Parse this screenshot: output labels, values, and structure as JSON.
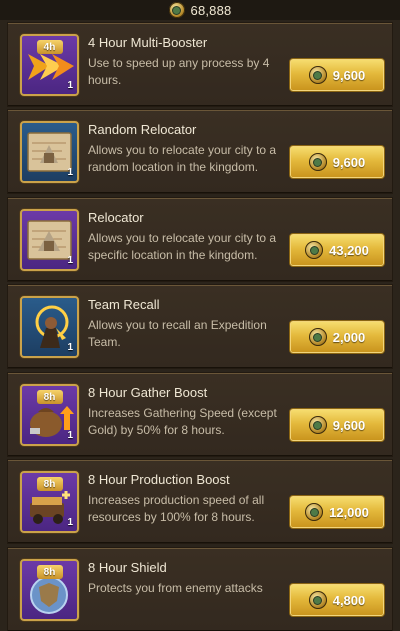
{
  "header": {
    "currency_icon": "coin-icon",
    "currency_total": "68,888"
  },
  "items": [
    {
      "name": "4 Hour Multi-Booster",
      "description": "Use to speed up any process by 4 hours.",
      "badge": "4h",
      "quantity": "1",
      "price": "9,600",
      "icon": "multi-booster-icon",
      "frame_color": "#6c3aa7"
    },
    {
      "name": "Random Relocator",
      "description": "Allows you to relocate your city to a random location in the kingdom.",
      "badge": "",
      "quantity": "1",
      "price": "9,600",
      "icon": "random-relocator-icon",
      "frame_color": "#2a5c8b"
    },
    {
      "name": "Relocator",
      "description": "Allows you to relocate your city to a specific location in the kingdom.",
      "badge": "",
      "quantity": "1",
      "price": "43,200",
      "icon": "relocator-icon",
      "frame_color": "#6c3aa7"
    },
    {
      "name": "Team Recall",
      "description": "Allows you to recall an Expedition Team.",
      "badge": "",
      "quantity": "1",
      "price": "2,000",
      "icon": "team-recall-icon",
      "frame_color": "#2a5c8b"
    },
    {
      "name": "8 Hour Gather Boost",
      "description": "Increases Gathering Speed (except Gold) by 50% for 8 hours.",
      "badge": "8h",
      "quantity": "1",
      "price": "9,600",
      "icon": "gather-boost-icon",
      "frame_color": "#6c3aa7"
    },
    {
      "name": "8 Hour Production Boost",
      "description": "Increases production speed of all resources by 100% for 8 hours.",
      "badge": "8h",
      "quantity": "1",
      "price": "12,000",
      "icon": "production-boost-icon",
      "frame_color": "#6c3aa7"
    },
    {
      "name": "8 Hour Shield",
      "description": "Protects you from enemy attacks",
      "badge": "8h",
      "quantity": "",
      "price": "4,800",
      "icon": "shield-icon",
      "frame_color": "#6c3aa7"
    }
  ]
}
